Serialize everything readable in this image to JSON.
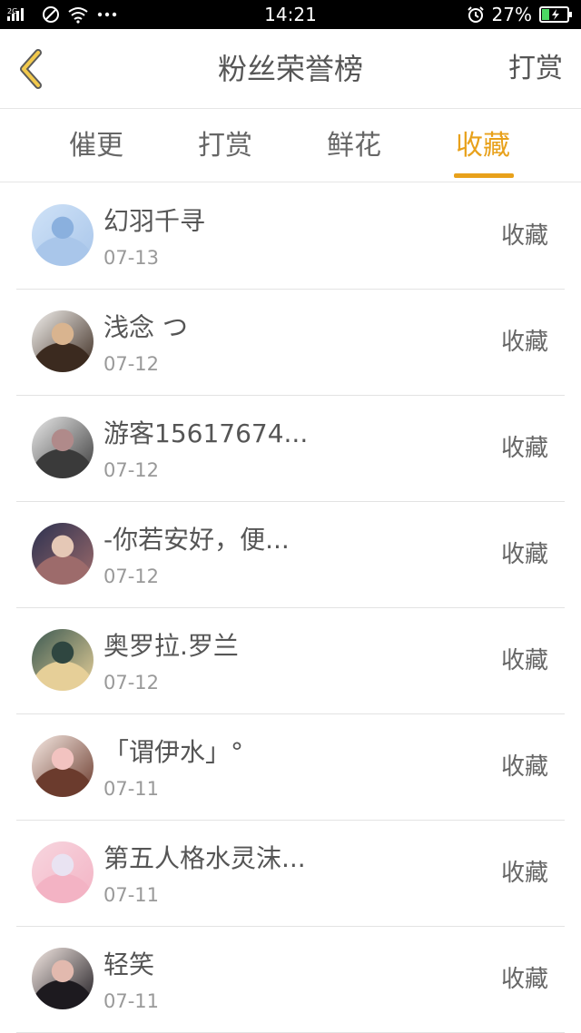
{
  "status_bar": {
    "network": "2G",
    "time": "14:21",
    "battery_percent": "27%"
  },
  "header": {
    "title": "粉丝荣誉榜",
    "reward_label": "打赏",
    "back_icon": "chevron-left-icon"
  },
  "tabs": [
    {
      "label": "催更",
      "active": false
    },
    {
      "label": "打赏",
      "active": false
    },
    {
      "label": "鲜花",
      "active": false
    },
    {
      "label": "收藏",
      "active": true
    }
  ],
  "colors": {
    "accent": "#e8a11b",
    "text": "#555555",
    "muted": "#999999",
    "divider": "#e3e3e3"
  },
  "fans": [
    {
      "name": "幻羽千寻",
      "date": "07-13",
      "action": "收藏",
      "avatar_colors": [
        "#cfe2f7",
        "#a9c6ea",
        "#8ab0de"
      ]
    },
    {
      "name": "浅念 つ",
      "date": "07-12",
      "action": "收藏",
      "avatar_colors": [
        "#f3f1ee",
        "#3b2a1f",
        "#d9b48f"
      ]
    },
    {
      "name": "游客15617674...",
      "date": "07-12",
      "action": "收藏",
      "avatar_colors": [
        "#e9e9e9",
        "#3a3a3a",
        "#b08a8a"
      ]
    },
    {
      "name": "-你若安好，便...",
      "date": "07-12",
      "action": "收藏",
      "avatar_colors": [
        "#2c3150",
        "#9d6b6b",
        "#e5c8b6"
      ]
    },
    {
      "name": "奥罗拉.罗兰",
      "date": "07-12",
      "action": "收藏",
      "avatar_colors": [
        "#3d5a52",
        "#e6cf98",
        "#2f4640"
      ]
    },
    {
      "name": "「谓伊水」°",
      "date": "07-11",
      "action": "收藏",
      "avatar_colors": [
        "#f6e9e3",
        "#6b3b2d",
        "#f2c3c0"
      ]
    },
    {
      "name": "第五人格水灵沫...",
      "date": "07-11",
      "action": "收藏",
      "avatar_colors": [
        "#f7d6df",
        "#f3b3c4",
        "#e9e3f2"
      ]
    },
    {
      "name": "轻笑",
      "date": "07-11",
      "action": "收藏",
      "avatar_colors": [
        "#f5e9e4",
        "#1d1a1f",
        "#e2b9ae"
      ]
    }
  ]
}
